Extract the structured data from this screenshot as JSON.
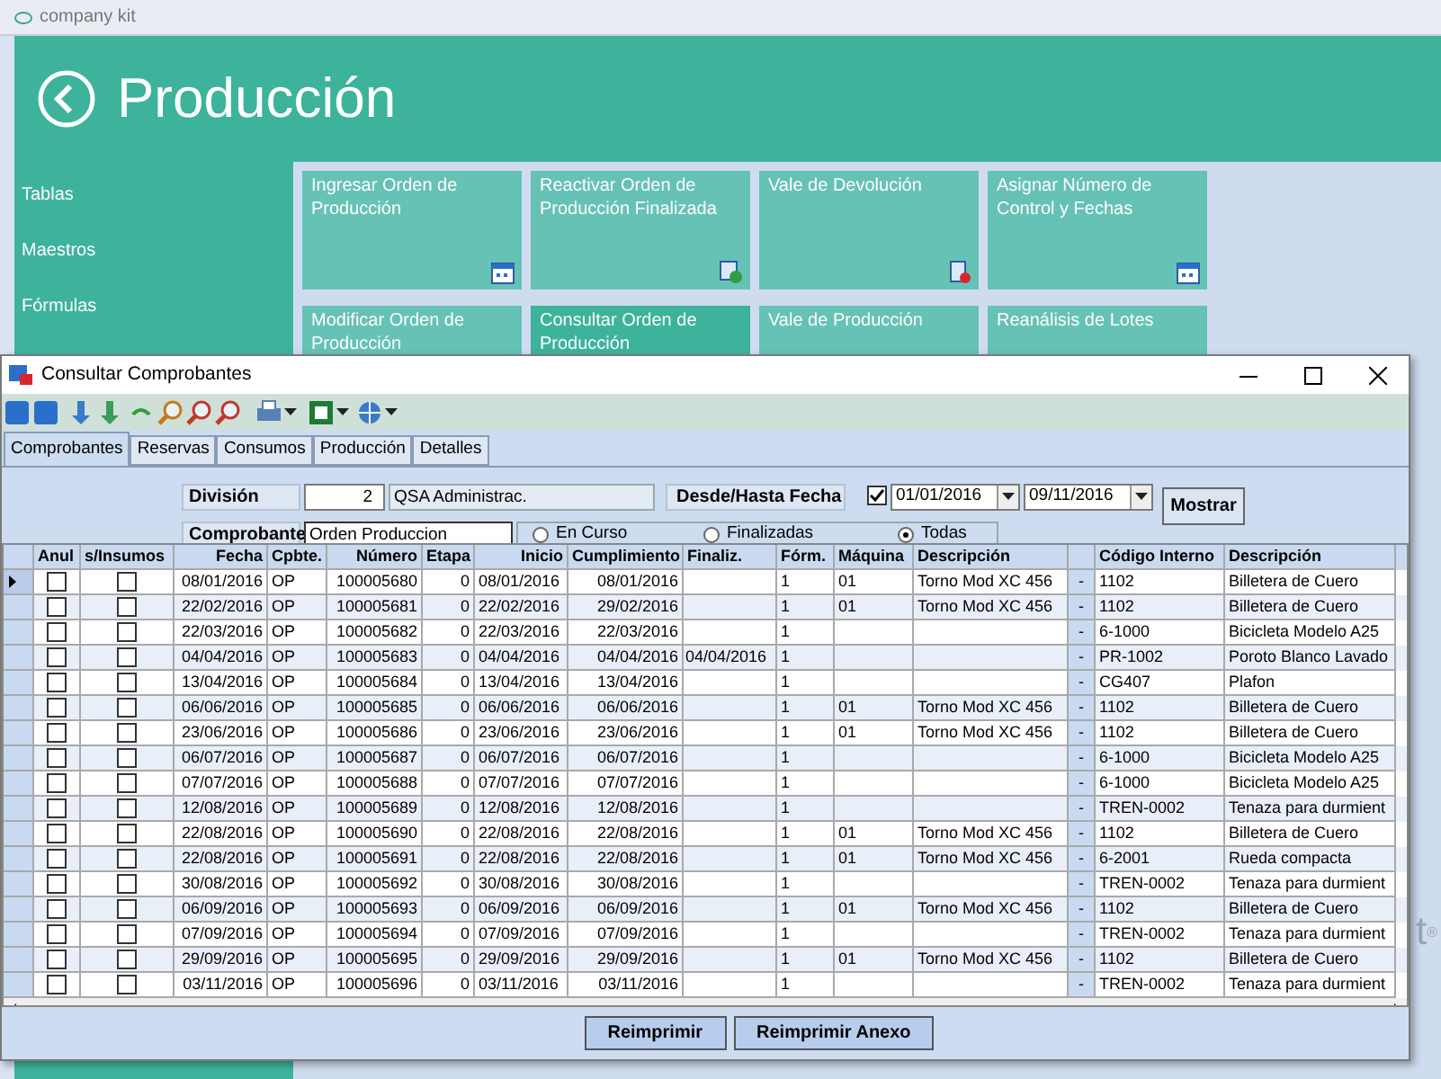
{
  "app": {
    "title": "company kit",
    "heading": "Producción",
    "sidebar": [
      {
        "label": "Tablas"
      },
      {
        "label": "Maestros"
      },
      {
        "label": "Fórmulas"
      }
    ],
    "tiles": [
      {
        "label": "Ingresar Orden de Producción",
        "selected": false,
        "kind": "calendar"
      },
      {
        "label": "Reactivar Orden de Producción Finalizada",
        "selected": false,
        "kind": "refresh"
      },
      {
        "label": "Vale de Devolución",
        "selected": false,
        "kind": "doc"
      },
      {
        "label": "Asignar Número de Control y Fechas",
        "selected": false,
        "kind": "calendar"
      },
      {
        "label": "Modificar Orden de Producción",
        "selected": false
      },
      {
        "label": "Consultar Orden de Producción",
        "selected": true
      },
      {
        "label": "Vale de Producción",
        "selected": false
      },
      {
        "label": "Reanálisis de Lotes",
        "selected": false
      }
    ],
    "logo_fragment": "t$^{®}$"
  },
  "dialog": {
    "title": "Consultar Comprobantes",
    "tabs": [
      {
        "label": "Comprobantes",
        "selected": true
      },
      {
        "label": "Reservas",
        "selected": false
      },
      {
        "label": "Consumos",
        "selected": false
      },
      {
        "label": "Producción",
        "selected": false
      },
      {
        "label": "Detalles",
        "selected": false
      }
    ],
    "filters": {
      "division_label": "División",
      "division_code": "2",
      "division_name": "QSA Administrac.",
      "date_label": "Desde/Hasta Fecha",
      "date_enabled": true,
      "date_from": "01/01/2016",
      "date_to": "09/11/2016",
      "show_button": "Mostrar",
      "comprobante_label": "Comprobante",
      "comprobante": "Orden Produccion",
      "status": [
        {
          "label": "En Curso",
          "selected": false
        },
        {
          "label": "Finalizadas",
          "selected": false
        },
        {
          "label": "Todas",
          "selected": true
        }
      ]
    },
    "table": {
      "columns": [
        "Anul",
        "s/Insumos",
        "Fecha",
        "Cpbte.",
        "Número",
        "Etapa",
        "Inicio",
        "Cumplimiento",
        "Finaliz.",
        "Fórm.",
        "Máquina",
        "Descripción",
        "Código Interno",
        "Descripción"
      ],
      "rows": [
        {
          "selected": true,
          "anul": false,
          "insumos": false,
          "fecha": "08/01/2016",
          "cpbte": "OP",
          "numero": "100005680",
          "etapa": "0",
          "inicio": "08/01/2016",
          "cumplimiento": "08/01/2016",
          "finaliz": "",
          "form": "1",
          "maquina": "01",
          "descripcion": "Torno Mod XC 456",
          "dash": "-",
          "codigo": "1102",
          "producto": "Billetera de Cuero"
        },
        {
          "selected": false,
          "anul": false,
          "insumos": false,
          "fecha": "22/02/2016",
          "cpbte": "OP",
          "numero": "100005681",
          "etapa": "0",
          "inicio": "22/02/2016",
          "cumplimiento": "29/02/2016",
          "finaliz": "",
          "form": "1",
          "maquina": "01",
          "descripcion": "Torno Mod XC 456",
          "dash": "-",
          "codigo": "1102",
          "producto": "Billetera de Cuero"
        },
        {
          "selected": false,
          "anul": false,
          "insumos": false,
          "fecha": "22/03/2016",
          "cpbte": "OP",
          "numero": "100005682",
          "etapa": "0",
          "inicio": "22/03/2016",
          "cumplimiento": "22/03/2016",
          "finaliz": "",
          "form": "1",
          "maquina": "",
          "descripcion": "",
          "dash": "-",
          "codigo": "6-1000",
          "producto": "Bicicleta Modelo A25"
        },
        {
          "selected": false,
          "anul": false,
          "insumos": false,
          "fecha": "04/04/2016",
          "cpbte": "OP",
          "numero": "100005683",
          "etapa": "0",
          "inicio": "04/04/2016",
          "cumplimiento": "04/04/2016",
          "finaliz": "04/04/2016",
          "form": "1",
          "maquina": "",
          "descripcion": "",
          "dash": "-",
          "codigo": "PR-1002",
          "producto": "Poroto Blanco Lavado"
        },
        {
          "selected": false,
          "anul": false,
          "insumos": false,
          "fecha": "13/04/2016",
          "cpbte": "OP",
          "numero": "100005684",
          "etapa": "0",
          "inicio": "13/04/2016",
          "cumplimiento": "13/04/2016",
          "finaliz": "",
          "form": "1",
          "maquina": "",
          "descripcion": "",
          "dash": "-",
          "codigo": "CG407",
          "producto": "Plafon"
        },
        {
          "selected": false,
          "anul": false,
          "insumos": false,
          "fecha": "06/06/2016",
          "cpbte": "OP",
          "numero": "100005685",
          "etapa": "0",
          "inicio": "06/06/2016",
          "cumplimiento": "06/06/2016",
          "finaliz": "",
          "form": "1",
          "maquina": "01",
          "descripcion": "Torno Mod XC 456",
          "dash": "-",
          "codigo": "1102",
          "producto": "Billetera de Cuero"
        },
        {
          "selected": false,
          "anul": false,
          "insumos": false,
          "fecha": "23/06/2016",
          "cpbte": "OP",
          "numero": "100005686",
          "etapa": "0",
          "inicio": "23/06/2016",
          "cumplimiento": "23/06/2016",
          "finaliz": "",
          "form": "1",
          "maquina": "01",
          "descripcion": "Torno Mod XC 456",
          "dash": "-",
          "codigo": "1102",
          "producto": "Billetera de Cuero"
        },
        {
          "selected": false,
          "anul": false,
          "insumos": false,
          "fecha": "06/07/2016",
          "cpbte": "OP",
          "numero": "100005687",
          "etapa": "0",
          "inicio": "06/07/2016",
          "cumplimiento": "06/07/2016",
          "finaliz": "",
          "form": "1",
          "maquina": "",
          "descripcion": "",
          "dash": "-",
          "codigo": "6-1000",
          "producto": "Bicicleta Modelo A25"
        },
        {
          "selected": false,
          "anul": false,
          "insumos": false,
          "fecha": "07/07/2016",
          "cpbte": "OP",
          "numero": "100005688",
          "etapa": "0",
          "inicio": "07/07/2016",
          "cumplimiento": "07/07/2016",
          "finaliz": "",
          "form": "1",
          "maquina": "",
          "descripcion": "",
          "dash": "-",
          "codigo": "6-1000",
          "producto": "Bicicleta Modelo A25"
        },
        {
          "selected": false,
          "anul": false,
          "insumos": false,
          "fecha": "12/08/2016",
          "cpbte": "OP",
          "numero": "100005689",
          "etapa": "0",
          "inicio": "12/08/2016",
          "cumplimiento": "12/08/2016",
          "finaliz": "",
          "form": "1",
          "maquina": "",
          "descripcion": "",
          "dash": "-",
          "codigo": "TREN-0002",
          "producto": "Tenaza para durmient"
        },
        {
          "selected": false,
          "anul": false,
          "insumos": false,
          "fecha": "22/08/2016",
          "cpbte": "OP",
          "numero": "100005690",
          "etapa": "0",
          "inicio": "22/08/2016",
          "cumplimiento": "22/08/2016",
          "finaliz": "",
          "form": "1",
          "maquina": "01",
          "descripcion": "Torno Mod XC 456",
          "dash": "-",
          "codigo": "1102",
          "producto": "Billetera de Cuero"
        },
        {
          "selected": false,
          "anul": false,
          "insumos": false,
          "fecha": "22/08/2016",
          "cpbte": "OP",
          "numero": "100005691",
          "etapa": "0",
          "inicio": "22/08/2016",
          "cumplimiento": "22/08/2016",
          "finaliz": "",
          "form": "1",
          "maquina": "01",
          "descripcion": "Torno Mod XC 456",
          "dash": "-",
          "codigo": "6-2001",
          "producto": "Rueda compacta"
        },
        {
          "selected": false,
          "anul": false,
          "insumos": false,
          "fecha": "30/08/2016",
          "cpbte": "OP",
          "numero": "100005692",
          "etapa": "0",
          "inicio": "30/08/2016",
          "cumplimiento": "30/08/2016",
          "finaliz": "",
          "form": "1",
          "maquina": "",
          "descripcion": "",
          "dash": "-",
          "codigo": "TREN-0002",
          "producto": "Tenaza para durmient"
        },
        {
          "selected": false,
          "anul": false,
          "insumos": false,
          "fecha": "06/09/2016",
          "cpbte": "OP",
          "numero": "100005693",
          "etapa": "0",
          "inicio": "06/09/2016",
          "cumplimiento": "06/09/2016",
          "finaliz": "",
          "form": "1",
          "maquina": "01",
          "descripcion": "Torno Mod XC 456",
          "dash": "-",
          "codigo": "1102",
          "producto": "Billetera de Cuero"
        },
        {
          "selected": false,
          "anul": false,
          "insumos": false,
          "fecha": "07/09/2016",
          "cpbte": "OP",
          "numero": "100005694",
          "etapa": "0",
          "inicio": "07/09/2016",
          "cumplimiento": "07/09/2016",
          "finaliz": "",
          "form": "1",
          "maquina": "",
          "descripcion": "",
          "dash": "-",
          "codigo": "TREN-0002",
          "producto": "Tenaza para durmient"
        },
        {
          "selected": false,
          "anul": false,
          "insumos": false,
          "fecha": "29/09/2016",
          "cpbte": "OP",
          "numero": "100005695",
          "etapa": "0",
          "inicio": "29/09/2016",
          "cumplimiento": "29/09/2016",
          "finaliz": "",
          "form": "1",
          "maquina": "01",
          "descripcion": "Torno Mod XC 456",
          "dash": "-",
          "codigo": "1102",
          "producto": "Billetera de Cuero"
        },
        {
          "selected": false,
          "anul": false,
          "insumos": false,
          "fecha": "03/11/2016",
          "cpbte": "OP",
          "numero": "100005696",
          "etapa": "0",
          "inicio": "03/11/2016",
          "cumplimiento": "03/11/2016",
          "finaliz": "",
          "form": "1",
          "maquina": "",
          "descripcion": "",
          "dash": "-",
          "codigo": "TREN-0002",
          "producto": "Tenaza para durmient"
        }
      ]
    },
    "buttons": [
      "Reimprimir",
      "Reimprimir Anexo"
    ]
  }
}
